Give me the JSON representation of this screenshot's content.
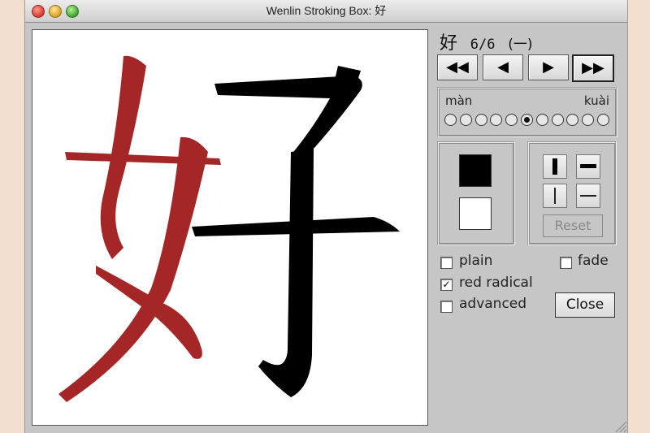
{
  "window": {
    "title": "Wenlin Stroking Box: 好"
  },
  "header": {
    "character": "好",
    "stroke_count": "6/6",
    "radical": "(一)"
  },
  "nav": {
    "first": "◀◀",
    "prev": "◀",
    "next": "▶",
    "last": "▶▶"
  },
  "speed": {
    "slow_label": "màn",
    "fast_label": "kuài",
    "positions": 11,
    "selected_index": 5
  },
  "colors": {
    "radical_stroke": "#a52626",
    "other_stroke": "#000000",
    "foreground_swatch": "#000000",
    "background_swatch": "#ffffff"
  },
  "options": {
    "plain": {
      "label": "plain",
      "checked": false
    },
    "fade": {
      "label": "fade",
      "checked": false
    },
    "red_radical": {
      "label": "red radical",
      "checked": true
    },
    "advanced": {
      "label": "advanced",
      "checked": false
    }
  },
  "buttons": {
    "reset": "Reset",
    "close": "Close"
  },
  "icons": [
    "thick-vertical-icon",
    "thick-horizontal-icon",
    "thin-vertical-icon",
    "thin-horizontal-icon",
    "resize-grip-icon"
  ]
}
